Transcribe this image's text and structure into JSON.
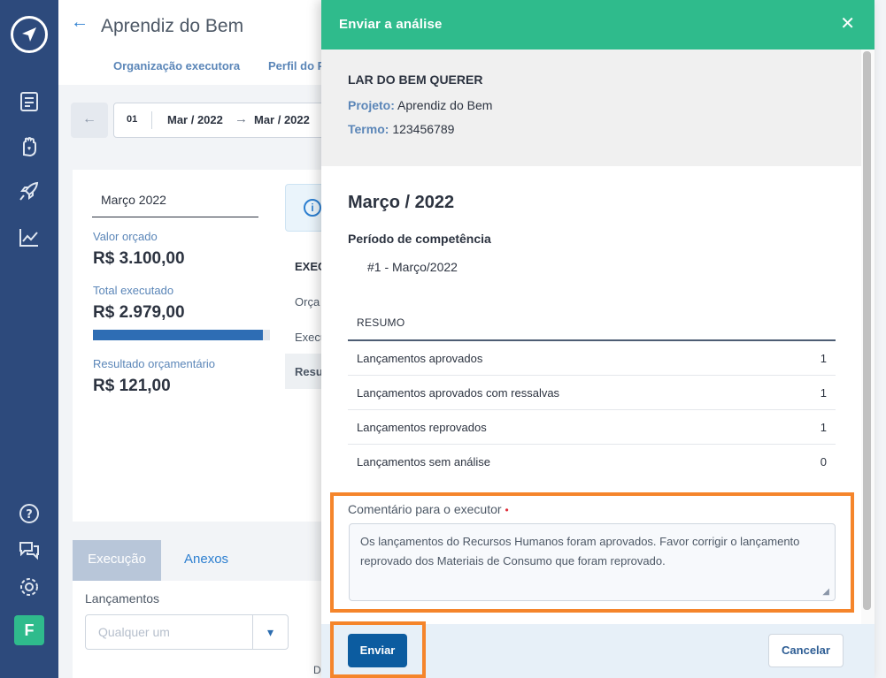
{
  "sidebar": {
    "avatar_initial": "F",
    "icons": [
      "document-icon",
      "hand-heart-icon",
      "rocket-icon",
      "chart-icon",
      "help-icon",
      "chat-icon",
      "settings-icon"
    ]
  },
  "page": {
    "title": "Aprendiz do Bem",
    "tabs": [
      "Organização executora",
      "Perfil do P"
    ],
    "date_range": {
      "index": "01",
      "from": "Mar / 2022",
      "to": "Mar / 2022"
    },
    "month_field": "Março 2022",
    "valor_orcado_label": "Valor orçado",
    "valor_orcado": "R$ 3.100,00",
    "total_executado_label": "Total executado",
    "total_executado": "R$ 2.979,00",
    "progress_fraction": 0.961,
    "resultado_label": "Resultado orçamentário",
    "resultado": "R$ 121,00",
    "table_head": "EXEC",
    "table_rows": [
      "Orça",
      "Execu",
      "Resu"
    ],
    "bottom_tabs": [
      "Execução",
      "Anexos"
    ],
    "lancamentos_label": "Lançamentos",
    "lancamentos_placeholder": "Qualquer um",
    "bottom_cut_text": "D"
  },
  "drawer": {
    "title": "Enviar a análise",
    "organization": "LAR DO BEM QUERER",
    "projeto_key": "Projeto:",
    "projeto_value": "Aprendiz do Bem",
    "termo_key": "Termo:",
    "termo_value": "123456789",
    "month_title": "Março / 2022",
    "period_label": "Período de competência",
    "period_value": "#1 - Março/2022",
    "resumo": {
      "header": "RESUMO",
      "rows": [
        {
          "label": "Lançamentos aprovados",
          "count": "1"
        },
        {
          "label": "Lançamentos aprovados com ressalvas",
          "count": "1"
        },
        {
          "label": "Lançamentos reprovados",
          "count": "1"
        },
        {
          "label": "Lançamentos sem análise",
          "count": "0"
        }
      ]
    },
    "comment_label": "Comentário para o executor",
    "comment_required_mark": "•",
    "comment_value": "Os lançamentos do Recursos Humanos foram aprovados. Favor corrigir o lançamento reprovado dos Materiais de Consumo que foram reprovado.",
    "send_label": "Enviar",
    "cancel_label": "Cancelar"
  },
  "colors": {
    "header_green": "#2fbb8c",
    "rail_blue": "#2d4a7c",
    "primary_button": "#0c5ca0",
    "highlight_orange": "#f5852b"
  }
}
